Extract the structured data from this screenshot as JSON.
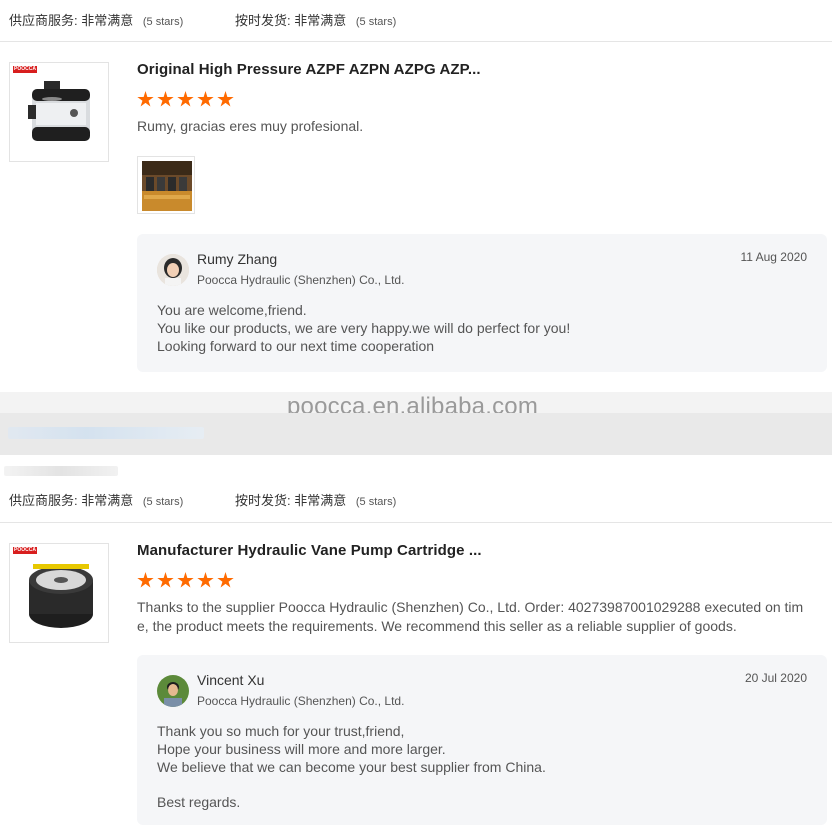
{
  "top_ratings": {
    "supplier_service_label": "供应商服务:",
    "supplier_service_value": "非常满意",
    "supplier_service_stars": "(5 stars)",
    "ontime_label": "按时发货:",
    "ontime_value": "非常满意",
    "ontime_stars": "(5 stars)"
  },
  "review1": {
    "brand_tag": "POOCCA",
    "title": "Original High Pressure AZPF AZPN AZPG AZP...",
    "rating": 5,
    "text": "Rumy, gracias eres muy profesional.",
    "reply": {
      "name": "Rumy Zhang",
      "company": "Poocca Hydraulic (Shenzhen) Co., Ltd.",
      "date": "11 Aug 2020",
      "lines": [
        "You are welcome,friend.",
        "You like our products, we are very happy.we will do perfect for you!",
        "Looking forward to our next time cooperation"
      ]
    }
  },
  "watermark": "poocca.en.alibaba.com",
  "bottom_ratings": {
    "supplier_service_label": "供应商服务:",
    "supplier_service_value": "非常满意",
    "supplier_service_stars": "(5 stars)",
    "ontime_label": "按时发货:",
    "ontime_value": "非常满意",
    "ontime_stars": "(5 stars)"
  },
  "review2": {
    "brand_tag": "POOCCA",
    "title": "Manufacturer Hydraulic Vane Pump Cartridge ...",
    "rating": 5,
    "text_lines": [
      "Thanks to the supplier Poocca Hydraulic (Shenzhen) Co., Ltd. Order: 40273987001029288 executed on tim",
      "e, the product meets the requirements. We recommend this seller as a reliable supplier of goods."
    ],
    "reply": {
      "name": "Vincent Xu",
      "company": "Poocca Hydraulic (Shenzhen) Co., Ltd.",
      "date": "20 Jul 2020",
      "lines": [
        "Thank you so much for your trust,friend,",
        "Hope your business will more and more larger.",
        "We believe that we can become your best supplier from China.",
        "",
        "Best regards."
      ]
    }
  },
  "icons": {
    "star": "star-icon",
    "avatar1": "avatar-woman",
    "avatar2": "avatar-man"
  },
  "colors": {
    "star": "#ff6a00",
    "reply_bg": "#f5f6f8",
    "band_bg": "#e9e9e9"
  }
}
